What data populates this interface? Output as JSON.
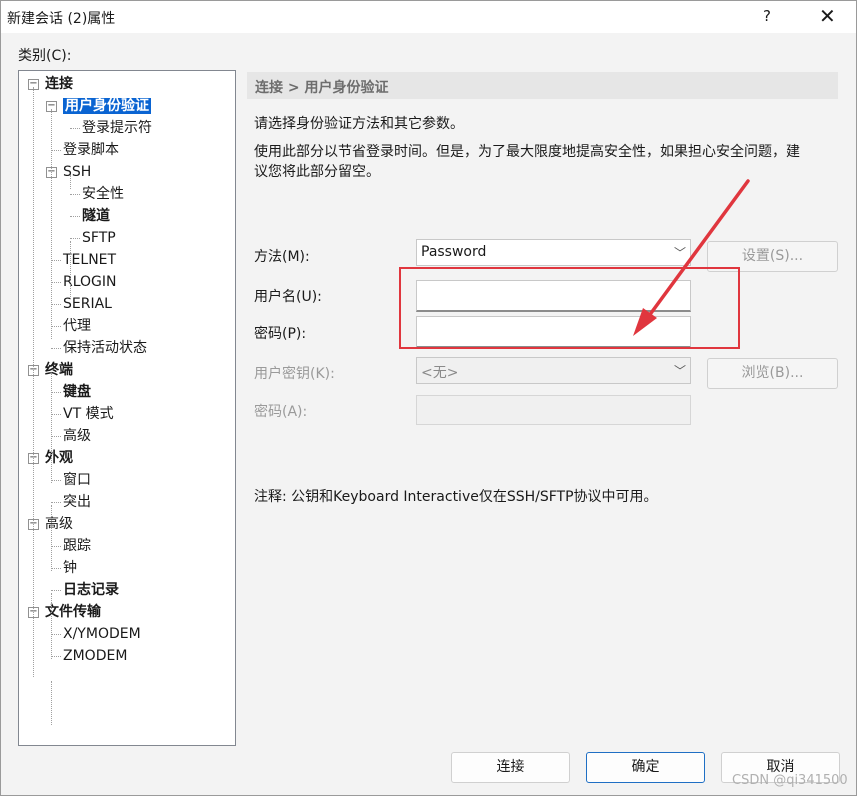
{
  "window": {
    "title": "新建会话 (2)属性",
    "help": "?",
    "close": "✕"
  },
  "category_label": "类别(C):",
  "tree": [
    {
      "label": "连接",
      "bold": true,
      "expander": "−"
    },
    {
      "label": "用户身份验证",
      "bold": true,
      "expander": "−",
      "selected": true
    },
    {
      "label": "登录提示符"
    },
    {
      "label": "登录脚本"
    },
    {
      "label": "SSH",
      "expander": "−"
    },
    {
      "label": "安全性"
    },
    {
      "label": "隧道",
      "bold": true
    },
    {
      "label": "SFTP"
    },
    {
      "label": "TELNET"
    },
    {
      "label": "RLOGIN"
    },
    {
      "label": "SERIAL"
    },
    {
      "label": "代理"
    },
    {
      "label": "保持活动状态"
    },
    {
      "label": "终端",
      "bold": true,
      "expander": "−"
    },
    {
      "label": "键盘",
      "bold": true
    },
    {
      "label": "VT 模式"
    },
    {
      "label": "高级"
    },
    {
      "label": "外观",
      "bold": true,
      "expander": "−"
    },
    {
      "label": "窗口"
    },
    {
      "label": "突出"
    },
    {
      "label": "高级",
      "expander": "−"
    },
    {
      "label": "跟踪"
    },
    {
      "label": "钟"
    },
    {
      "label": "日志记录",
      "bold": true
    },
    {
      "label": "文件传输",
      "bold": true,
      "expander": "−"
    },
    {
      "label": "X/YMODEM"
    },
    {
      "label": "ZMODEM"
    }
  ],
  "breadcrumb": "连接 > 用户身份验证",
  "description": {
    "line1": "请选择身份验证方法和其它参数。",
    "line2a": "使用此部分以节省登录时间。但是，为了最大限度地提高安全性，如果担心安全问题，建",
    "line2b": "议您将此部分留空。"
  },
  "form": {
    "method_label": "方法(M):",
    "method_value": "Password",
    "settings_button": "设置(S)...",
    "username_label": "用户名(U):",
    "username_value": "",
    "password_label": "密码(P):",
    "password_value": "",
    "userkey_label": "用户密钥(K):",
    "userkey_value": "<无>",
    "browse_button": "浏览(B)...",
    "passphrase_label": "密码(A):",
    "passphrase_value": ""
  },
  "note": "注释: 公钥和Keyboard Interactive仅在SSH/SFTP协议中可用。",
  "buttons": {
    "connect": "连接",
    "ok": "确定",
    "cancel": "取消"
  },
  "annotation_colors": {
    "highlight": "#e0363e"
  },
  "watermark": "CSDN @qi341500"
}
